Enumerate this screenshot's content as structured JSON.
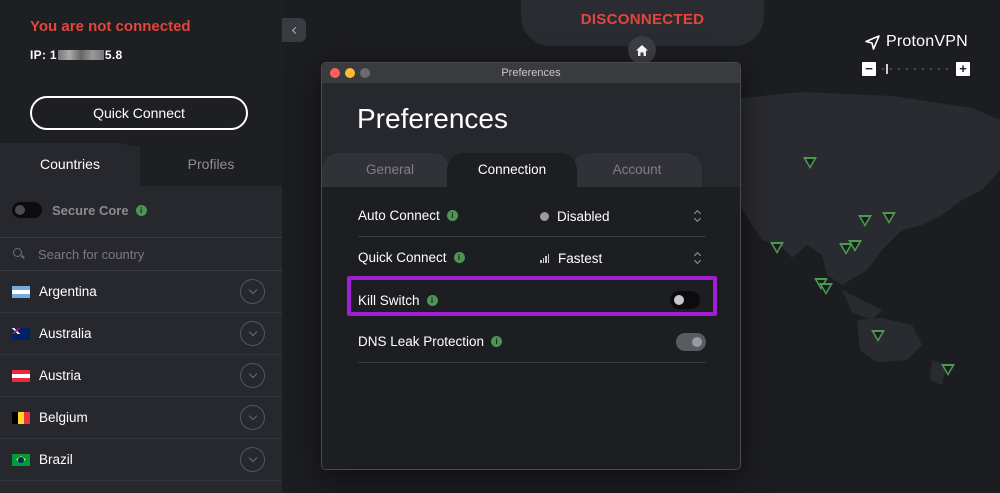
{
  "sidebar": {
    "status": "You are not connected",
    "ip_prefix": "IP: 1",
    "ip_suffix": "5.8",
    "quick_connect": "Quick Connect",
    "tabs": {
      "countries": "Countries",
      "profiles": "Profiles"
    },
    "secure_core": "Secure Core",
    "search_placeholder": "Search for country",
    "countries": [
      {
        "name": "Argentina"
      },
      {
        "name": "Australia"
      },
      {
        "name": "Austria"
      },
      {
        "name": "Belgium"
      },
      {
        "name": "Brazil"
      }
    ]
  },
  "map": {
    "status": "DISCONNECTED",
    "brand": "ProtonVPN",
    "zoom_in": "+",
    "zoom_out": "−",
    "zoom_level": 0.06
  },
  "preferences": {
    "window_title": "Preferences",
    "heading": "Preferences",
    "tabs": [
      "General",
      "Connection",
      "Account"
    ],
    "active_tab": "Connection",
    "settings": [
      {
        "label": "Auto Connect",
        "value": "Disabled",
        "control": "select",
        "value_icon": "gray-dot-icon"
      },
      {
        "label": "Quick Connect",
        "value": "Fastest",
        "control": "select",
        "value_icon": "signal-bars-icon"
      },
      {
        "label": "Kill Switch",
        "control": "toggle",
        "on": false,
        "highlighted": true
      },
      {
        "label": "DNS Leak Protection",
        "control": "toggle",
        "on": true,
        "disabled": true
      }
    ]
  },
  "colors": {
    "danger": "#e3463b",
    "accent_green": "#4d9455",
    "highlight": "#a21fd6",
    "background": "#1c1d21"
  }
}
